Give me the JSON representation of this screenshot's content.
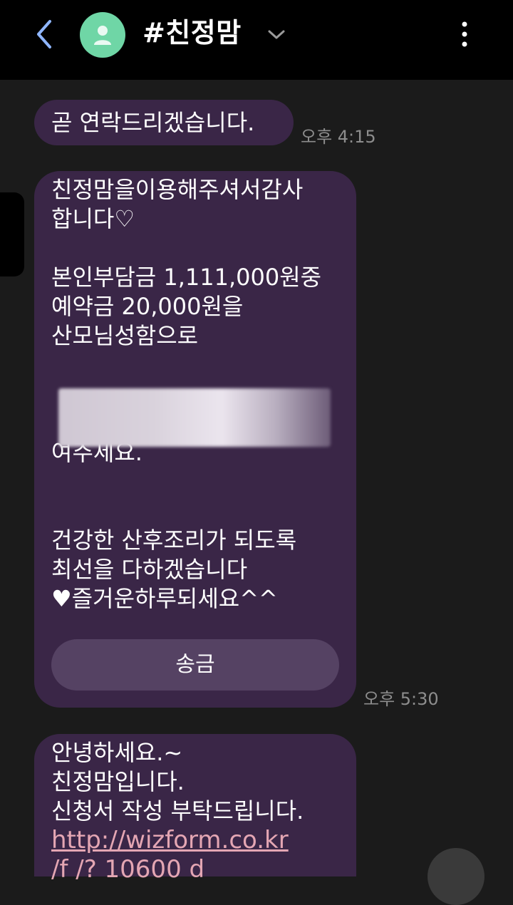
{
  "header": {
    "title": "#친정맘",
    "back_icon": "chevron-left-icon",
    "avatar_icon": "person-icon",
    "dropdown_icon": "chevron-down-icon",
    "menu_icon": "more-vertical-icon"
  },
  "messages": [
    {
      "text": "곧 연락드리겠습니다.",
      "time": "오후 4:15"
    },
    {
      "text": "친정맘을이용해주셔서감사\n합니다♡\n\n본인부담금 1,111,000원중\n예약금 20,000원을\n산모님성함으로\n\n\n        (친정맘)으로입금하\n여주세요.\n\n\n건강한 산후조리가 되도록\n최선을 다하겠습니다\n♥즐거운하루되세요^^",
      "button_label": "송금",
      "time": "오후 5:30"
    },
    {
      "text": "안녕하세요.~\n친정맘입니다.\n신청서 작성 부탁드립니다.",
      "link": "http://wizform.co.kr",
      "link_cut": "/f      /?      10600 d"
    }
  ],
  "colors": {
    "bubble": "#3a2647",
    "button": "#554263",
    "background": "#1b1b1b",
    "header": "#000000",
    "avatar": "#6fd6a6",
    "link": "#e4a6b3",
    "timestamp": "#8d8d8d"
  }
}
